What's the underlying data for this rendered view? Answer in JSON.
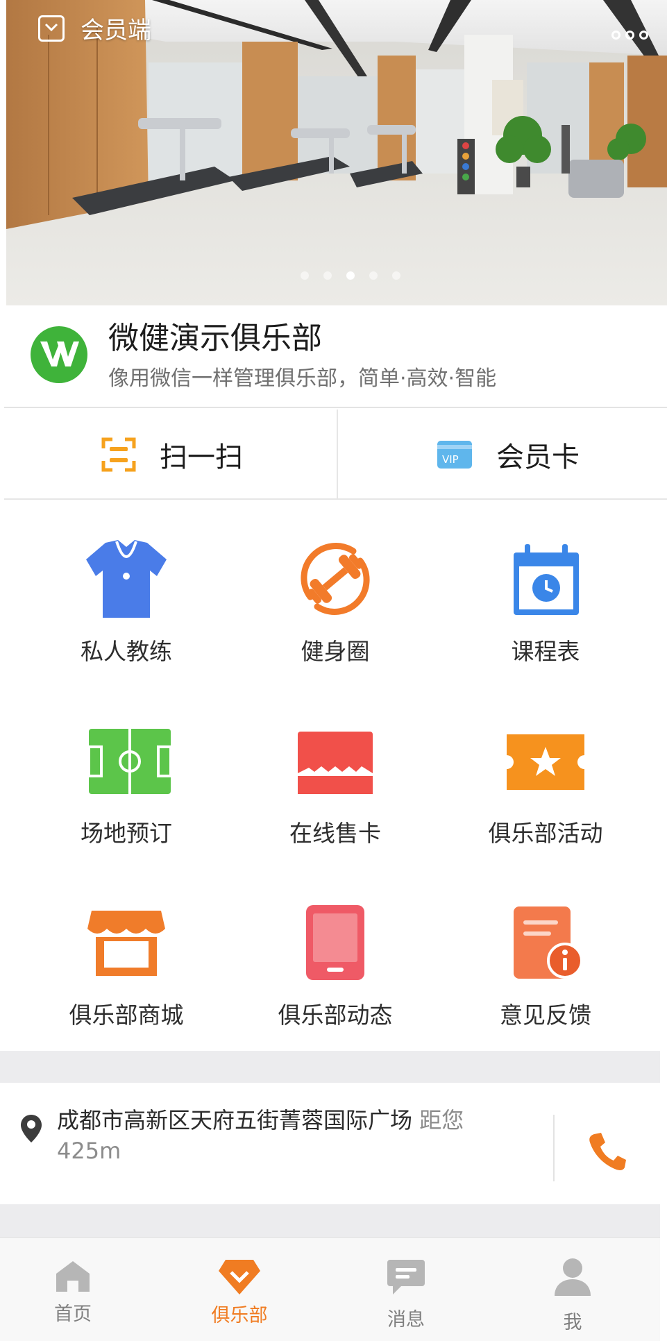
{
  "header": {
    "title": "会员端",
    "carousel_total": 5,
    "carousel_active": 3
  },
  "club": {
    "name": "微健演示俱乐部",
    "slogan": "像用微信一样管理俱乐部，简单·高效·智能"
  },
  "quick_actions": [
    {
      "label": "扫一扫",
      "icon": "scan-icon"
    },
    {
      "label": "会员卡",
      "icon": "vip-card-icon"
    }
  ],
  "features": [
    {
      "label": "私人教练",
      "icon": "coach-shirt-icon",
      "color": "#4a7ce8"
    },
    {
      "label": "健身圈",
      "icon": "dumbbell-icon",
      "color": "#f27b2a"
    },
    {
      "label": "课程表",
      "icon": "calendar-icon",
      "color": "#3a86e8"
    },
    {
      "label": "场地预订",
      "icon": "soccer-field-icon",
      "color": "#5cc54a"
    },
    {
      "label": "在线售卡",
      "icon": "ticket-card-icon",
      "color": "#f1504a"
    },
    {
      "label": "俱乐部活动",
      "icon": "star-ticket-icon",
      "color": "#f6921e"
    },
    {
      "label": "俱乐部商城",
      "icon": "shop-icon",
      "color": "#f07c2a"
    },
    {
      "label": "俱乐部动态",
      "icon": "tablet-icon",
      "color": "#ef5a66"
    },
    {
      "label": "意见反馈",
      "icon": "feedback-icon",
      "color": "#f06c3c"
    }
  ],
  "location": {
    "address": "成都市高新区天府五街菁蓉国际广场",
    "distance_prefix": "距您",
    "distance": "425m"
  },
  "tabs": [
    {
      "label": "首页",
      "icon": "home-icon",
      "active": false
    },
    {
      "label": "俱乐部",
      "icon": "club-icon",
      "active": true
    },
    {
      "label": "消息",
      "icon": "message-icon",
      "active": false
    },
    {
      "label": "我",
      "icon": "user-icon",
      "active": false
    }
  ],
  "colors": {
    "accent": "#f07c22",
    "logo_green": "#3fb33a",
    "phone": "#f07c22"
  }
}
